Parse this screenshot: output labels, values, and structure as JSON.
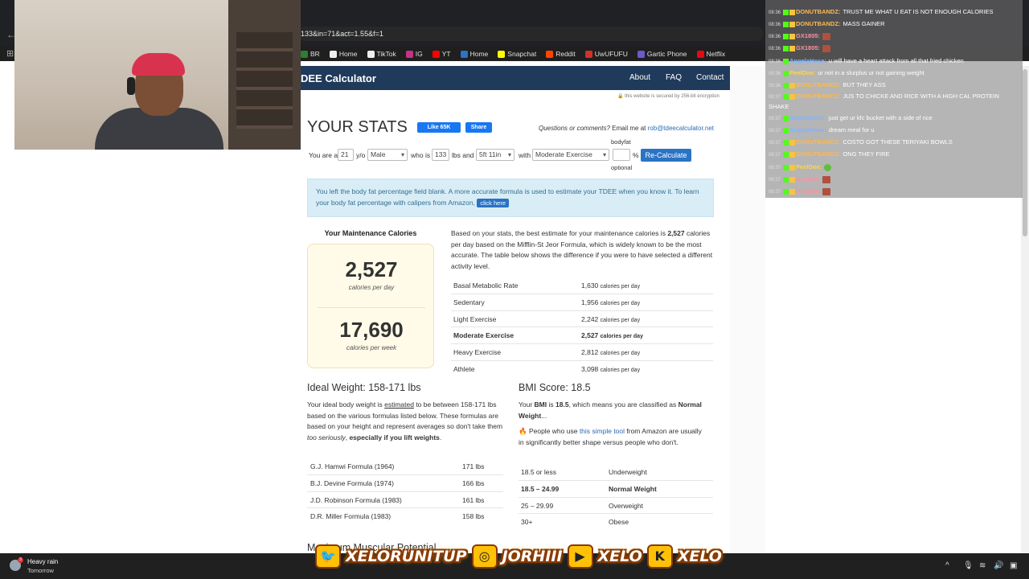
{
  "browser": {
    "url": "133&in=71&act=1.55&f=1",
    "bookmarks": [
      {
        "label": "BR",
        "color": "#2e7d32"
      },
      {
        "label": "Home",
        "color": "#111111"
      },
      {
        "label": "TikTok",
        "color": "#111111"
      },
      {
        "label": "IG",
        "color": "#c13584"
      },
      {
        "label": "YT",
        "color": "#ff0000"
      },
      {
        "label": "Home",
        "color": "#2a73c5"
      },
      {
        "label": "Snapchat",
        "color": "#fffc00"
      },
      {
        "label": "Reddit",
        "color": "#ff4500"
      },
      {
        "label": "UwUFUFU",
        "color": "#d32f2f"
      },
      {
        "label": "Gartic Phone",
        "color": "#6a5acd"
      },
      {
        "label": "Netflix",
        "color": "#e50914"
      }
    ]
  },
  "site": {
    "logo": "DEE Calculator",
    "nav": {
      "about": "About",
      "faq": "FAQ",
      "contact": "Contact"
    },
    "secure_note": "this website is secured by 256-bit encryption"
  },
  "stats": {
    "heading": "YOUR STATS",
    "fb_like": "Like 65K",
    "fb_share": "Share",
    "questions_lead": "Questions or comments?",
    "questions_email_label": " Email me at ",
    "email": "rob@tdeecalculator.net",
    "form": {
      "you_are_a": "You are a",
      "age": "21",
      "yo": "y/o",
      "sex": "Male",
      "who_is": "who is",
      "weight": "133",
      "lbs_and": "lbs and",
      "height": "5ft 11in",
      "with": "with",
      "activity": "Moderate Exercise",
      "bodyfat_label": "bodyfat",
      "percent": "%",
      "optional": "optional",
      "recalc": "Re-Calculate"
    }
  },
  "info_box": {
    "text": "You left the body fat percentage field blank. A more accurate formula is used to estimate your TDEE when you know it. To learn your body fat percentage with calipers from Amazon, ",
    "button": "click here"
  },
  "maintenance": {
    "title": "Your Maintenance Calories",
    "daily": "2,527",
    "daily_label": "calories per day",
    "weekly": "17,690",
    "weekly_label": "calories per week",
    "desc_pre": "Based on your stats, the best estimate for your maintenance calories is ",
    "desc_bold": "2,527",
    "desc_post": " calories per day based on the Mifflin-St Jeor Formula, which is widely known to be the most accurate. The table below shows the difference if you were to have selected a different activity level.",
    "unit": "calories per day",
    "rows": [
      {
        "label": "Basal Metabolic Rate",
        "value": "1,630"
      },
      {
        "label": "Sedentary",
        "value": "1,956"
      },
      {
        "label": "Light Exercise",
        "value": "2,242"
      },
      {
        "label": "Moderate Exercise",
        "value": "2,527"
      },
      {
        "label": "Heavy Exercise",
        "value": "2,812"
      },
      {
        "label": "Athlete",
        "value": "3,098"
      }
    ]
  },
  "ideal_weight": {
    "heading": "Ideal Weight: 158-171 lbs",
    "desc_1": "Your ideal body weight is ",
    "desc_link": "estimated",
    "desc_2": " to be between 158-171 lbs based on the various formulas listed below. These formulas are based on your height and represent averages so don't take them ",
    "desc_italic": "too seriously",
    "desc_3": ", ",
    "desc_bold": "especially if you lift weights",
    "desc_4": ".",
    "rows": [
      {
        "name": "G.J. Hamwi Formula (1964)",
        "value": "171 lbs"
      },
      {
        "name": "B.J. Devine Formula (1974)",
        "value": "166 lbs"
      },
      {
        "name": "J.D. Robinson Formula (1983)",
        "value": "161 lbs"
      },
      {
        "name": "D.R. Miller Formula (1983)",
        "value": "158 lbs"
      }
    ]
  },
  "bmi": {
    "heading": "BMI Score: 18.5",
    "desc_1": "Your ",
    "desc_bmi": "BMI",
    "desc_2": " is ",
    "desc_val": "18.5",
    "desc_3": ", which means you are classified as ",
    "desc_class": "Normal Weight",
    "desc_4": "...",
    "tip_1": " People who use ",
    "tip_link": "this simple tool",
    "tip_2": " from Amazon are usually in significantly better shape versus people who don't.",
    "rows": [
      {
        "range": "18.5 or less",
        "class": "Underweight"
      },
      {
        "range": "18.5 – 24.99",
        "class": "Normal Weight"
      },
      {
        "range": "25 – 29.99",
        "class": "Overweight"
      },
      {
        "range": "30+",
        "class": "Obese"
      }
    ]
  },
  "next_section": "Maximum Muscular Potential",
  "chat": [
    {
      "time": "08:36",
      "name": "DONUTBANDZ:",
      "color": "#ffb84d",
      "msg": "TRUST ME WHAT U EAT IS NOT ENOUGH CALORIES"
    },
    {
      "time": "08:36",
      "name": "DONUTBANDZ:",
      "color": "#ffb84d",
      "msg": "MASS GAINER"
    },
    {
      "time": "08:36",
      "name": "GX1805:",
      "color": "#ff8fa3",
      "msg": ""
    },
    {
      "time": "08:36",
      "name": "GX1805:",
      "color": "#ff8fa3",
      "msg": ""
    },
    {
      "time": "08:36",
      "name": "AngelaHose:",
      "color": "#7fb3ff",
      "msg": "u will have a heart attack from all that fried chicken"
    },
    {
      "time": "08:36",
      "name": "PeelDoe:",
      "color": "#ffd54f",
      "msg": "ur not in a slurplus ur not gaining weight"
    },
    {
      "time": "08:36",
      "name": "DONUTBANDZ:",
      "color": "#ffb84d",
      "msg": "BUT THEY ASS"
    },
    {
      "time": "08:37",
      "name": "DONUTBANDZ:",
      "color": "#ffb84d",
      "msg": "JUS TO CHICKE AND RICE WITH A HIGH CAL PROTEIN SHAKE"
    },
    {
      "time": "08:37",
      "name": "AngelaHose:",
      "color": "#7fb3ff",
      "msg": "just get ur kfc bucket with a side of rice"
    },
    {
      "time": "08:37",
      "name": "AngelaHose:",
      "color": "#7fb3ff",
      "msg": "dream meal for u"
    },
    {
      "time": "08:37",
      "name": "DONUTBANDZ:",
      "color": "#ffb84d",
      "msg": "COSTO GOT THESE TERIYAKI BOWLS"
    },
    {
      "time": "08:37",
      "name": "DONUTBANDZ:",
      "color": "#ffb84d",
      "msg": "ONG THEY FIRE"
    },
    {
      "time": "08:37",
      "name": "PeelDoe:",
      "color": "#ffd54f",
      "msg": ""
    },
    {
      "time": "08:37",
      "name": "GX1805:",
      "color": "#ff8fa3",
      "msg": ""
    },
    {
      "time": "08:37",
      "name": "GX1805:",
      "color": "#ff8fa3",
      "msg": ""
    }
  ],
  "social": {
    "twitter": "XELORUNITUP",
    "instagram": "JORHIII",
    "youtube": "XELO",
    "kick": "XELO"
  },
  "taskbar": {
    "weather_main": "Heavy rain",
    "weather_sub": "Tomorrow",
    "weather_badge": "3"
  }
}
